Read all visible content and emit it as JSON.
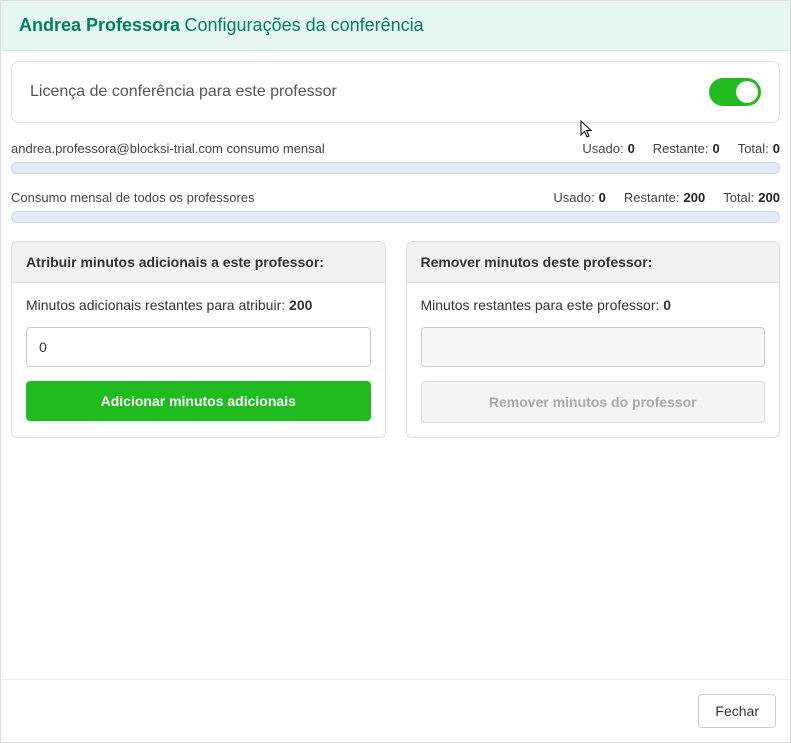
{
  "header": {
    "name": "Andrea Professora",
    "subtitle": "Configurações da conferência"
  },
  "license": {
    "label": "Licença de conferência para este professor",
    "enabled": true
  },
  "usage_teacher": {
    "label": "andrea.professora@blocksi-trial.com consumo mensal",
    "used_label": "Usado:",
    "used_value": "0",
    "remaining_label": "Restante:",
    "remaining_value": "0",
    "total_label": "Total:",
    "total_value": "0"
  },
  "usage_all": {
    "label": "Consumo mensal de todos os professores",
    "used_label": "Usado:",
    "used_value": "0",
    "remaining_label": "Restante:",
    "remaining_value": "200",
    "total_label": "Total:",
    "total_value": "200"
  },
  "panel_assign": {
    "title": "Atribuir minutos adicionais a este professor:",
    "info_label": "Minutos adicionais restantes para atribuir: ",
    "info_value": "200",
    "input_value": "0",
    "button": "Adicionar minutos adicionais"
  },
  "panel_remove": {
    "title": "Remover minutos deste professor:",
    "info_label": "Minutos restantes para este professor: ",
    "info_value": "0",
    "button": "Remover minutos do professor"
  },
  "footer": {
    "close": "Fechar"
  }
}
